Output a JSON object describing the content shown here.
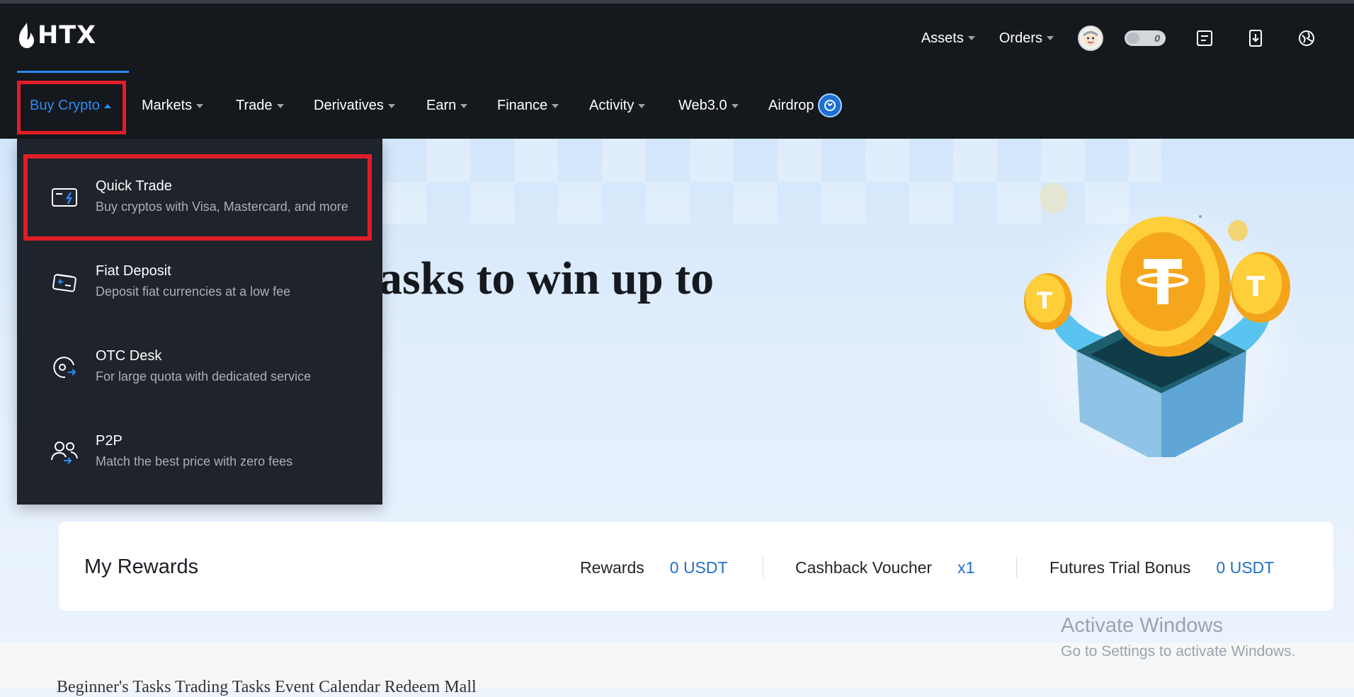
{
  "brand": {
    "name": "HTX"
  },
  "header": {
    "right_menu": [
      {
        "label": "Assets",
        "icon": "caret-down"
      },
      {
        "label": "Orders",
        "icon": "caret-down"
      }
    ],
    "toggle_count": "0",
    "icons": [
      "avatar",
      "toggle-switch-icon",
      "messages-icon",
      "download-icon",
      "language-globe-icon"
    ]
  },
  "nav": {
    "items": [
      {
        "label": "Buy Crypto",
        "active": true
      },
      {
        "label": "Markets"
      },
      {
        "label": "Trade"
      },
      {
        "label": "Derivatives"
      },
      {
        "label": "Earn"
      },
      {
        "label": "Finance"
      },
      {
        "label": "Activity"
      },
      {
        "label": "Web3.0"
      },
      {
        "label": "Airdrop"
      }
    ]
  },
  "dropdown": {
    "items": [
      {
        "title": "Quick Trade",
        "desc": "Buy cryptos with Visa, Mastercard, and more",
        "icon": "card-lightning-icon"
      },
      {
        "title": "Fiat Deposit",
        "desc": "Deposit fiat currencies at a low fee",
        "icon": "fiat-card-icon"
      },
      {
        "title": "OTC Desk",
        "desc": "For large quota with dedicated service",
        "icon": "otc-exchange-icon"
      },
      {
        "title": "P2P",
        "desc": "Match the best price with zero fees",
        "icon": "users-exchange-icon"
      }
    ]
  },
  "hero": {
    "title_fragment": "asks to win up to"
  },
  "rewards": {
    "title": "My Rewards",
    "items": [
      {
        "label": "Rewards",
        "value": "0 USDT"
      },
      {
        "label": "Cashback Voucher",
        "value": "x1"
      },
      {
        "label": "Futures Trial Bonus",
        "value": "0 USDT"
      }
    ]
  },
  "bottom_fragment": "Beginner's Tasks     Trading Tasks     Event Calendar     Redeem Mall",
  "windows_watermark": {
    "line1": "Activate Windows",
    "line2": "Go to Settings to activate Windows."
  },
  "colors": {
    "accent": "#2b8cf0",
    "highlight": "#e01d28",
    "header_bg": "#15181d",
    "dropdown_bg": "#1f232b"
  }
}
